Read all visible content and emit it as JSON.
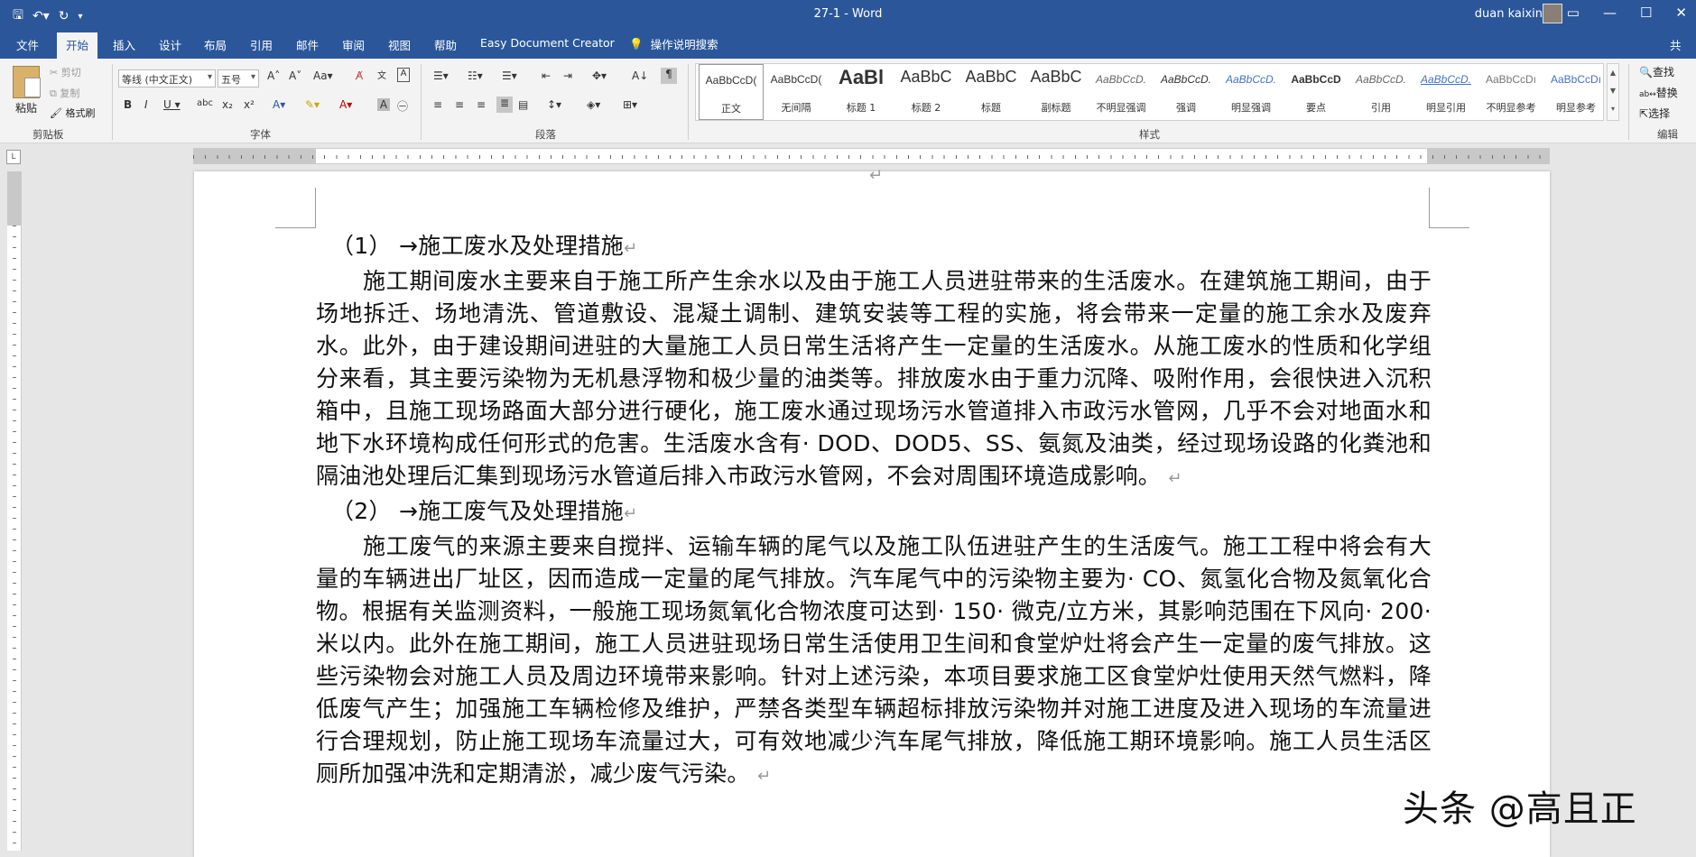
{
  "window": {
    "title": "27-1  -  Word",
    "user": "duan kaixin"
  },
  "qat": {
    "save_icon": "save-icon",
    "undo_icon": "undo-icon",
    "redo_icon": "redo-icon",
    "customize_icon": "customize-icon"
  },
  "tabs": [
    "文件",
    "开始",
    "插入",
    "设计",
    "布局",
    "引用",
    "邮件",
    "审阅",
    "视图",
    "帮助",
    "Easy Document Creator"
  ],
  "tell_me": "操作说明搜索",
  "ribbon": {
    "clipboard": {
      "paste": "粘贴",
      "cut": "剪切",
      "copy": "复制",
      "format_painter": "格式刷",
      "label": "剪贴板"
    },
    "font": {
      "font_name": "等线 (中文正文)",
      "font_size": "五号",
      "label": "字体"
    },
    "paragraph": {
      "label": "段落"
    },
    "styles": {
      "label": "样式",
      "items": [
        {
          "sample": "AaBbCcD(",
          "name": "正文"
        },
        {
          "sample": "AaBbCcD(",
          "name": "无间隔"
        },
        {
          "sample": "AaBl",
          "name": "标题 1"
        },
        {
          "sample": "AaBbC",
          "name": "标题 2"
        },
        {
          "sample": "AaBbC",
          "name": "标题"
        },
        {
          "sample": "AaBbC",
          "name": "副标题"
        },
        {
          "sample": "AaBbCcD.",
          "name": "不明显强调"
        },
        {
          "sample": "AaBbCcD.",
          "name": "强调"
        },
        {
          "sample": "AaBbCcD.",
          "name": "明显强调"
        },
        {
          "sample": "AaBbCcD",
          "name": "要点"
        },
        {
          "sample": "AaBbCcD.",
          "name": "引用"
        },
        {
          "sample": "AaBbCcD.",
          "name": "明显引用"
        },
        {
          "sample": "AaBbCcDı",
          "name": "不明显参考"
        },
        {
          "sample": "AaBbCcDı",
          "name": "明显参考"
        }
      ]
    },
    "editing": {
      "find": "查找",
      "replace": "替换",
      "select": "选择",
      "label": "编辑"
    },
    "share": "共"
  },
  "document": {
    "heading1": "（1）  →施工废水及处理措施",
    "para1": "施工期间废水主要来自于施工所产生余水以及由于施工人员进驻带来的生活废水。在建筑施工期间，由于场地拆迁、场地清洗、管道敷设、混凝土调制、建筑安装等工程的实施，将会带来一定量的施工余水及废弃水。此外，由于建设期间进驻的大量施工人员日常生活将产生一定量的生活废水。从施工废水的性质和化学组分来看，其主要污染物为无机悬浮物和极少量的油类等。排放废水由于重力沉降、吸附作用，会很快进入沉积箱中，且施工现场路面大部分进行硬化，施工废水通过现场污水管道排入市政污水管网，几乎不会对地面水和地下水环境构成任何形式的危害。生活废水含有· DOD、DOD5、SS、氨氮及油类，经过现场设路的化粪池和隔油池处理后汇集到现场污水管道后排入市政污水管网，不会对周围环境造成影响。",
    "heading2": "（2）  →施工废气及处理措施",
    "para2": "施工废气的来源主要来自搅拌、运输车辆的尾气以及施工队伍进驻产生的生活废气。施工工程中将会有大量的车辆进出厂址区，因而造成一定量的尾气排放。汽车尾气中的污染物主要为· CO、氮氢化合物及氮氧化合物。根据有关监测资料，一般施工现场氮氧化合物浓度可达到· 150· 微克/立方米，其影响范围在下风向· 200· 米以内。此外在施工期间，施工人员进驻现场日常生活使用卫生间和食堂炉灶将会产生一定量的废气排放。这些污染物会对施工人员及周边环境带来影响。针对上述污染，本项目要求施工区食堂炉灶使用天然气燃料，降低废气产生；加强施工车辆检修及维护，严禁各类型车辆超标排放污染物并对施工进度及进入现场的车流量进行合理规划，防止施工现场车流量过大，可有效地减少汽车尾气排放，降低施工期环境影响。施工人员生活区厕所加强冲洗和定期清淤，减少废气污染。",
    "pilcrow": "↵"
  },
  "watermark": "头条 @高且正"
}
